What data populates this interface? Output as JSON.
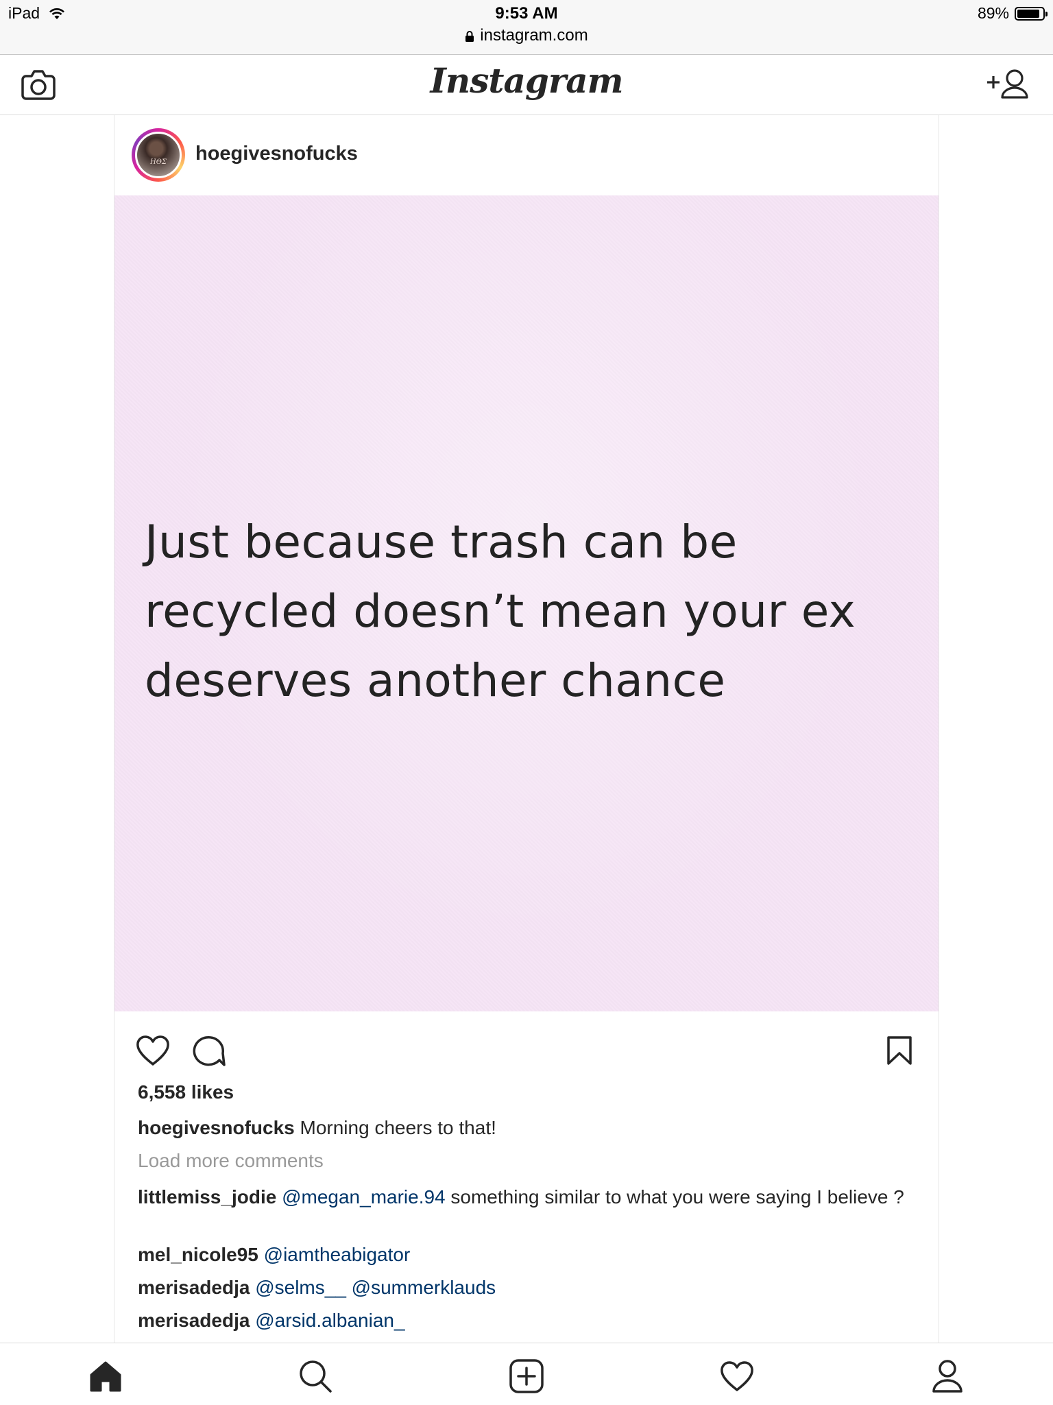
{
  "status_bar": {
    "device": "iPad",
    "time": "9:53 AM",
    "url": "instagram.com",
    "battery": "89%",
    "battery_level": 0.89
  },
  "header": {
    "logo": "Instagram",
    "icons": {
      "left": "camera-icon",
      "right": "add-user-icon"
    }
  },
  "post": {
    "username": "hoegivesnofucks",
    "avatar_text": "HΘΣ",
    "image_text": "Just because trash can be recycled doesn’t mean your ex deserves another chance",
    "image_background": "#f5e4f5",
    "icons": {
      "like": "heart-icon",
      "comment": "comment-icon",
      "save": "bookmark-icon"
    },
    "likes": "6,558 likes",
    "caption": {
      "user": "hoegivesnofucks",
      "text": "Morning cheers to that!"
    },
    "load_more": "Load more comments",
    "comments": [
      {
        "user": "littlemiss_jodie",
        "mentions": [
          "@megan_marie.94"
        ],
        "text": "something similar to what you were saying I believe ?"
      },
      {
        "user": "mel_nicole95",
        "mentions": [
          "@iamtheabigator"
        ],
        "text": ""
      },
      {
        "user": "merisadedja",
        "mentions": [
          "@selms__",
          "@summerklauds"
        ],
        "text": ""
      },
      {
        "user": "merisadedja",
        "mentions": [
          "@arsid.albanian_"
        ],
        "text": ""
      }
    ]
  },
  "bottom_nav": [
    "home-icon",
    "search-icon",
    "new-post-icon",
    "activity-heart-icon",
    "profile-icon"
  ],
  "colors": {
    "text": "#262626",
    "mention": "#003569",
    "muted": "#999999",
    "border": "#dbdbdb"
  }
}
